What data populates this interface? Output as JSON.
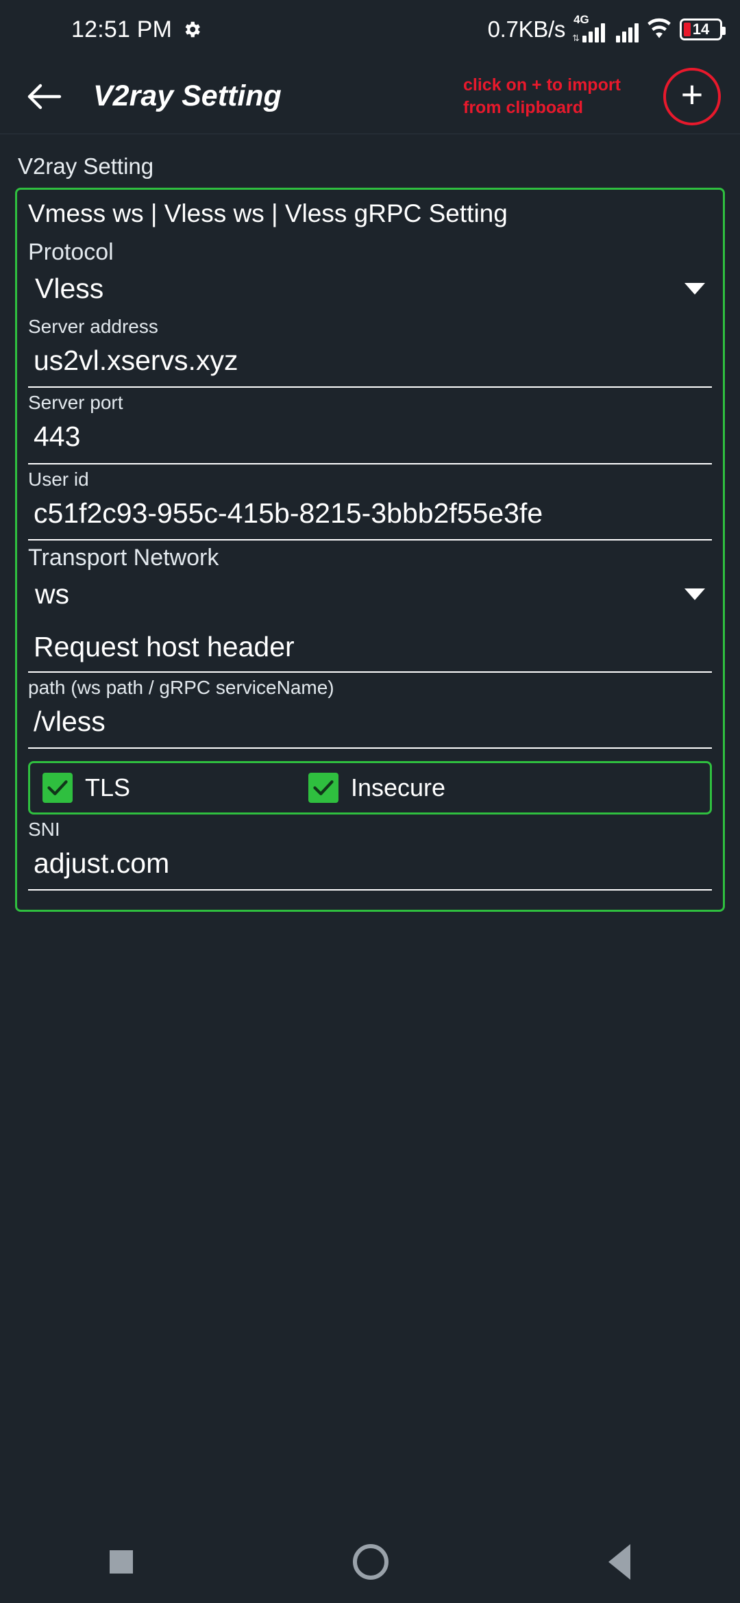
{
  "status_bar": {
    "time": "12:51 PM",
    "gear_icon": "gear-icon",
    "net_speed": "0.7KB/s",
    "network_type": "4G",
    "signal_icon": "signal-bars-icon",
    "signal2_icon": "signal-bars-icon",
    "wifi_icon": "wifi-icon",
    "battery_level": "14"
  },
  "app_bar": {
    "back_icon": "back-arrow-icon",
    "title": "V2ray Setting",
    "hint_line1": "click on + to import",
    "hint_line2": "from clipboard",
    "add_label": "+"
  },
  "page": {
    "section_label": "V2ray Setting",
    "card_title": "Vmess ws | Vless ws | Vless gRPC Setting",
    "fields": {
      "protocol_label": "Protocol",
      "protocol_value": "Vless",
      "server_address_label": "Server address",
      "server_address_value": "us2vl.xservs.xyz",
      "server_port_label": "Server port",
      "server_port_value": "443",
      "user_id_label": "User id",
      "user_id_value": "c51f2c93-955c-415b-8215-3bbb2f55e3fe",
      "transport_network_label": "Transport Network",
      "transport_network_value": "ws",
      "request_host_header_placeholder": "Request host header",
      "path_label": "path (ws path / gRPC serviceName)",
      "path_value": "/vless",
      "tls_label": "TLS",
      "insecure_label": "Insecure",
      "sni_label": "SNI",
      "sni_value": "adjust.com"
    }
  },
  "nav_bar": {
    "recents": "recents-square-icon",
    "home": "home-circle-icon",
    "back": "back-triangle-icon"
  },
  "colors": {
    "background": "#1d242b",
    "accent_green": "#2fbf3f",
    "accent_red": "#e8192c",
    "text": "#ffffff"
  }
}
